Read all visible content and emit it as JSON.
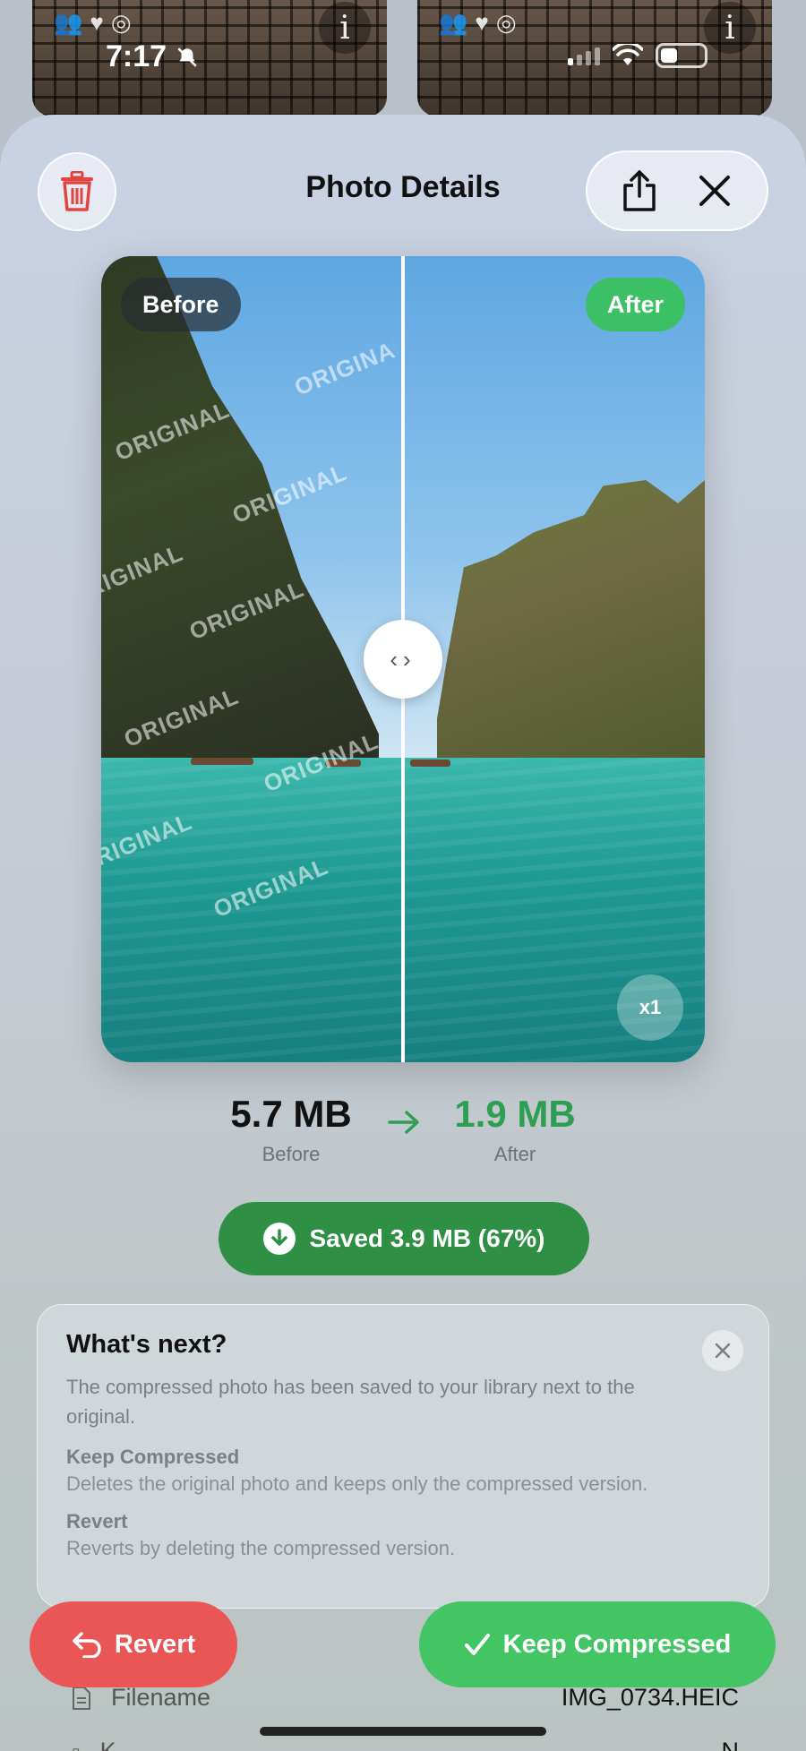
{
  "status_bar": {
    "time": "7:17"
  },
  "header": {
    "title": "Photo Details",
    "delete_icon": "trash-icon",
    "share_icon": "share-icon",
    "close_icon": "close-icon"
  },
  "compare": {
    "before_label": "Before",
    "after_label": "After",
    "watermark_text": "ORIGINAL",
    "zoom_label": "x1"
  },
  "sizes": {
    "before_value": "5.7 MB",
    "before_caption": "Before",
    "after_value": "1.9 MB",
    "after_caption": "After"
  },
  "saved_badge": {
    "label": "Saved 3.9 MB (67%)"
  },
  "info_card": {
    "title": "What's next?",
    "body": "The compressed photo has been saved to your library next to the original.",
    "keep_title": "Keep Compressed",
    "keep_text": "Deletes the original photo and keeps only the compressed version.",
    "revert_title": "Revert",
    "revert_text": "Reverts by deleting the compressed version."
  },
  "actions": {
    "revert_label": "Revert",
    "keep_label": "Keep Compressed"
  },
  "metadata": {
    "filename_label": "Filename",
    "filename_value": "IMG_0734.HEIC",
    "row2_label": "K",
    "row2_value": "N"
  },
  "colors": {
    "accent_green": "#43c563",
    "saved_green": "#2e8f45",
    "danger_red": "#ea5556"
  }
}
